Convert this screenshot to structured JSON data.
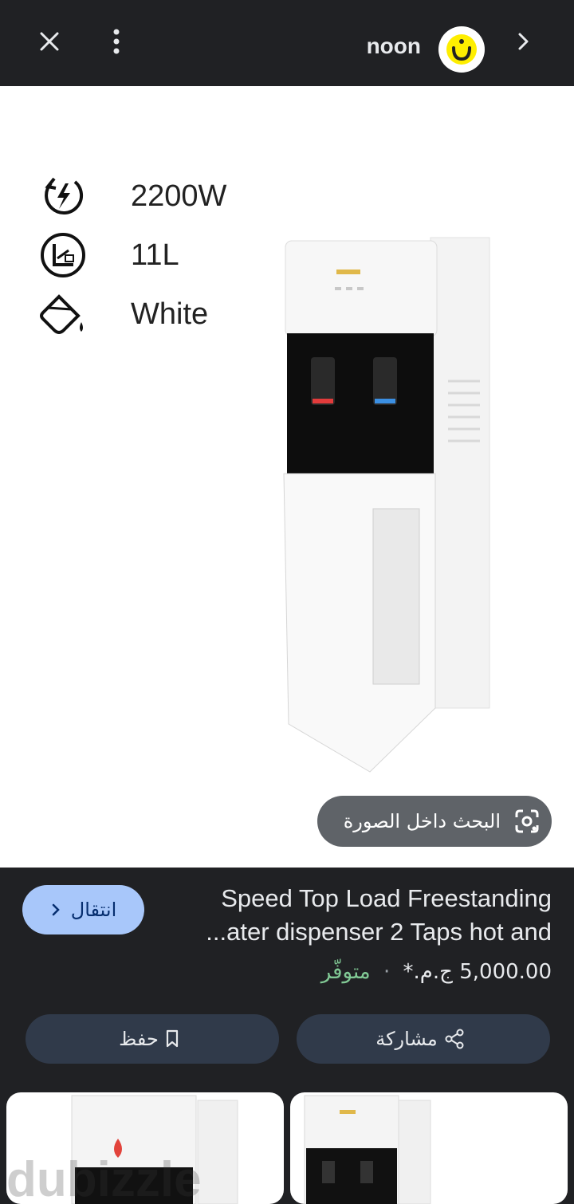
{
  "topbar": {
    "brand_name": "noon",
    "icons": [
      "close-icon",
      "more-vert-icon",
      "noon-logo",
      "chevron-right-icon"
    ]
  },
  "image": {
    "specs": [
      {
        "icon": "power-icon",
        "text": "2200W"
      },
      {
        "icon": "capacity-icon",
        "text": "11L"
      },
      {
        "icon": "paint-bucket-icon",
        "text": "White"
      }
    ],
    "lens_label": "البحث داخل الصورة"
  },
  "result": {
    "title_line1": "Speed Top Load Freestanding",
    "title_line2": "...ater dispenser 2 Taps hot and",
    "visit_label": "انتقال",
    "price": "5,000.00 ج.م.*",
    "separator": "·",
    "stock": "متوفّر",
    "share_label": "مشاركة",
    "save_label": "حفظ"
  },
  "related": {
    "watermark": "dubizzle"
  },
  "colors": {
    "background": "#202124",
    "chip_blue": "#a8c7fa",
    "action_bg": "#303a4a",
    "stock_green": "#81c995"
  }
}
